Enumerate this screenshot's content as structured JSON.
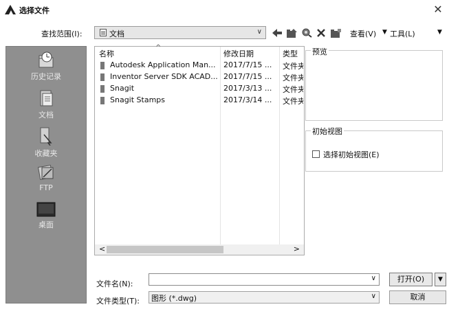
{
  "window": {
    "title": "选择文件",
    "close_glyph": "✕"
  },
  "toolbar": {
    "lookin_label": "查找范围(I):",
    "lookin_value": "文档",
    "views_label": "查看(V)",
    "tools_label": "工具(L)",
    "icons": [
      "back-icon",
      "up-folder-icon",
      "search-web-icon",
      "delete-icon",
      "new-folder-icon"
    ]
  },
  "places": [
    {
      "label": "历史记录",
      "icon": "history-icon"
    },
    {
      "label": "文档",
      "icon": "documents-icon"
    },
    {
      "label": "收藏夹",
      "icon": "favorites-icon"
    },
    {
      "label": "FTP",
      "icon": "ftp-icon"
    },
    {
      "label": "桌面",
      "icon": "desktop-icon"
    }
  ],
  "file_list": {
    "columns": [
      "名称",
      "修改日期",
      "类型"
    ],
    "rows": [
      {
        "name": "Autodesk Application Man...",
        "date": "2017/7/15 ...",
        "type": "文件夹"
      },
      {
        "name": "Inventor Server SDK ACAD...",
        "date": "2017/7/15 ...",
        "type": "文件夹"
      },
      {
        "name": "Snagit",
        "date": "2017/3/13 ...",
        "type": "文件夹"
      },
      {
        "name": "Snagit Stamps",
        "date": "2017/3/14 ...",
        "type": "文件夹"
      }
    ]
  },
  "preview": {
    "label": "预览"
  },
  "initial_view": {
    "label": "初始视图",
    "checkbox_label": "选择初始视图(E)",
    "checked": false
  },
  "filename": {
    "label": "文件名(N):",
    "value": ""
  },
  "filetype": {
    "label": "文件类型(T):",
    "value": "图形 (*.dwg)"
  },
  "buttons": {
    "open": "打开(O)",
    "cancel": "取消"
  },
  "colors": {
    "places_bg": "#8f8f8f",
    "scroll_thumb": "#c6c6c6"
  }
}
